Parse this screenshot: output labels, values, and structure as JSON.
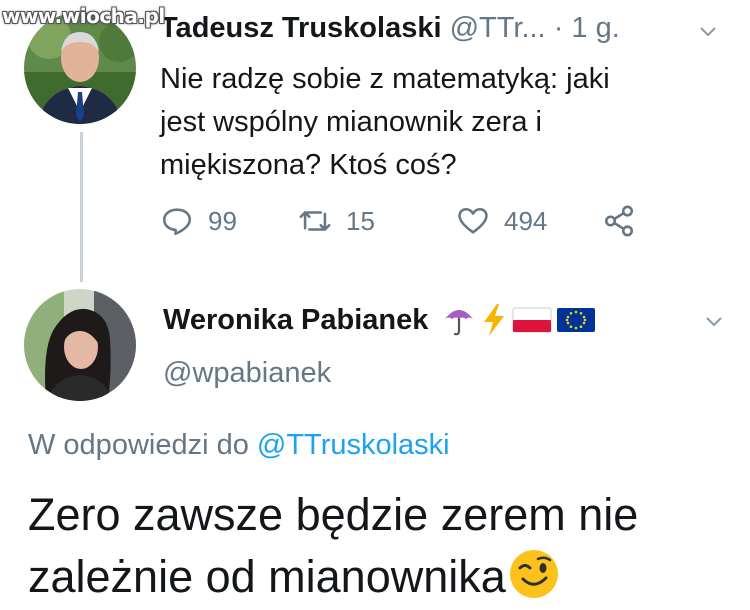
{
  "watermark": "www.wiocha.pl",
  "tweet1": {
    "author_name": "Tadeusz Truskolaski",
    "handle": "@TTr...",
    "separator": "·",
    "time": "1 g.",
    "text": "Nie radzę sobie z matematyką: jaki jest wspólny mianownik zera i miękiszona? Ktoś coś?",
    "replies": "99",
    "retweets": "15",
    "likes": "494"
  },
  "tweet2": {
    "author_name": "Weronika Pabianek",
    "handle": "@wpabianek",
    "reply_prefix": "W odpowiedzi do",
    "reply_to": "@TTruskolaski",
    "text": "Zero zawsze będzie zerem nie zależnie od mianownika"
  },
  "colors": {
    "text": "#14171a",
    "secondary": "#657786",
    "link": "#1da1f2",
    "thread_line": "#c8d2da"
  }
}
